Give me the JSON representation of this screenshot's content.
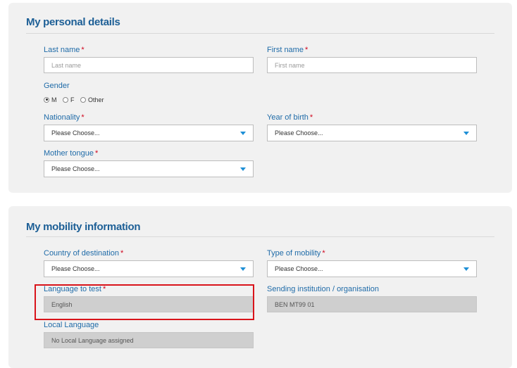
{
  "personal": {
    "title": "My personal details",
    "last_name": {
      "label": "Last name",
      "placeholder": "Last name"
    },
    "first_name": {
      "label": "First name",
      "placeholder": "First name"
    },
    "gender": {
      "label": "Gender",
      "options": [
        "M",
        "F",
        "Other"
      ],
      "selected": "M"
    },
    "nationality": {
      "label": "Nationality",
      "value": "Please Choose..."
    },
    "year_of_birth": {
      "label": "Year of birth",
      "value": "Please Choose..."
    },
    "mother_tongue": {
      "label": "Mother tongue",
      "value": "Please Choose..."
    }
  },
  "mobility": {
    "title": "My mobility information",
    "country": {
      "label": "Country of destination",
      "value": "Please Choose..."
    },
    "type": {
      "label": "Type of mobility",
      "value": "Please Choose..."
    },
    "language_to_test": {
      "label": "Language to test",
      "value": "English"
    },
    "sending_institution": {
      "label": "Sending institution / organisation",
      "value": "BEN MT99 01"
    },
    "local_language": {
      "label": "Local Language",
      "value": "No Local Language assigned"
    }
  },
  "required_marker": "*",
  "colors": {
    "accent": "#1d5f96",
    "label": "#1f6ba8",
    "required": "#d0021b",
    "caret": "#1d8fd6",
    "highlight": "#d9141b"
  }
}
